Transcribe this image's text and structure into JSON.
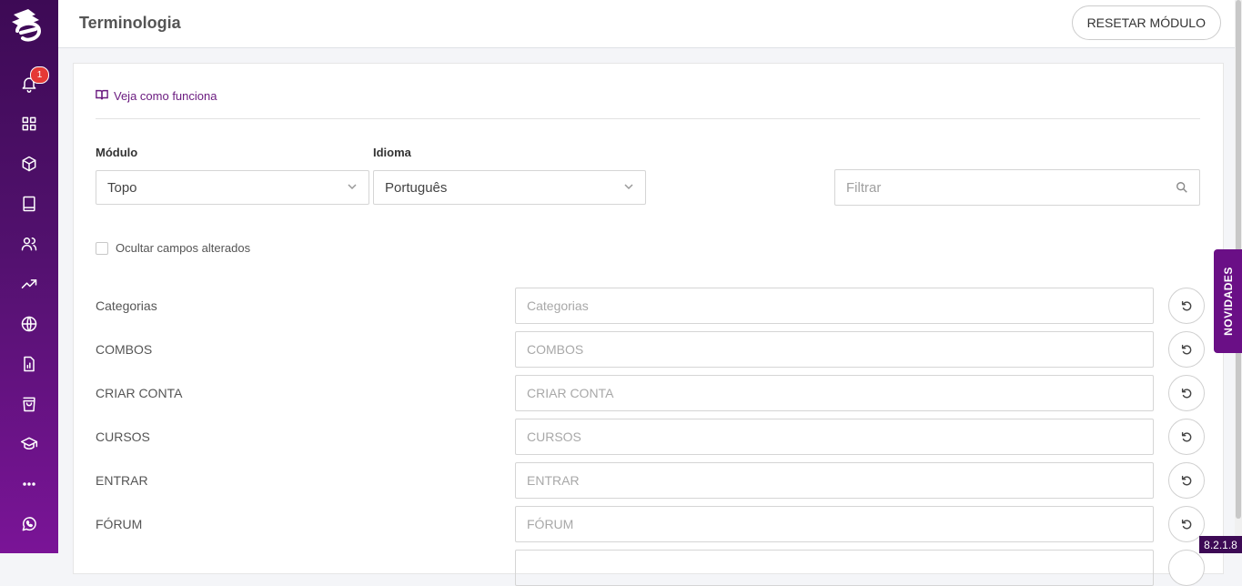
{
  "sidebar": {
    "notification_count": "1",
    "icons": [
      "logo-icon",
      "bell-icon",
      "grid-icon",
      "box-icon",
      "book-icon",
      "users-icon",
      "trending-icon",
      "globe-icon",
      "report-icon",
      "shopping-bag-icon",
      "graduation-cap-icon",
      "more-icon",
      "whatsapp-icon"
    ]
  },
  "header": {
    "title": "Terminologia",
    "reset_label": "RESETAR MÓDULO"
  },
  "content": {
    "howto_link": "Veja como funciona",
    "module_label": "Módulo",
    "module_value": "Topo",
    "language_label": "Idioma",
    "language_value": "Português",
    "filter_placeholder": "Filtrar",
    "hide_changed_label": "Ocultar campos alterados",
    "terms": [
      {
        "label": "Categorias",
        "placeholder": "Categorias"
      },
      {
        "label": "COMBOS",
        "placeholder": "COMBOS"
      },
      {
        "label": "CRIAR CONTA",
        "placeholder": "CRIAR CONTA"
      },
      {
        "label": "CURSOS",
        "placeholder": "CURSOS"
      },
      {
        "label": "ENTRAR",
        "placeholder": "ENTRAR"
      },
      {
        "label": "FÓRUM",
        "placeholder": "FÓRUM"
      }
    ]
  },
  "novidades_label": "NOVIDADES",
  "version": "8.2.1.8",
  "colors": {
    "sidebar_top": "#3d0a55",
    "sidebar_bottom": "#7a1497",
    "accent": "#6a0f86",
    "badge": "#e53935"
  }
}
